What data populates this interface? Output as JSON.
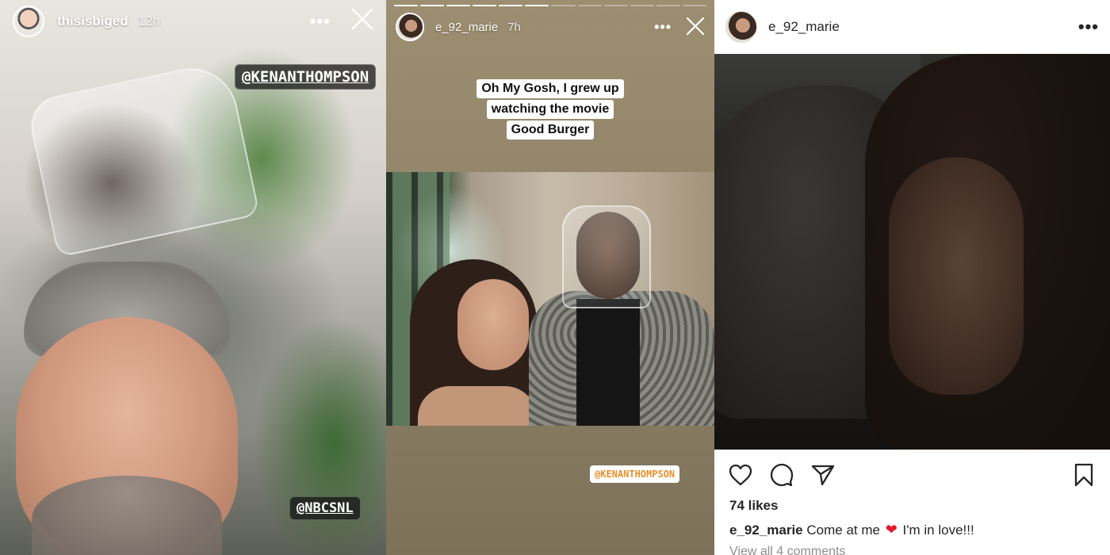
{
  "story1": {
    "username": "thisisbiged",
    "time": "12h",
    "more_icon": "more-dots-icon",
    "close_icon": "close-icon",
    "tags": {
      "kenan": "@KENANTHOMPSON",
      "nbc": "@NBCSNL"
    }
  },
  "story2": {
    "username": "e_92_marie",
    "time": "7h",
    "more_icon": "more-dots-icon",
    "close_icon": "close-icon",
    "caption_lines": [
      "Oh My Gosh, I grew up",
      "watching the movie",
      "Good Burger"
    ],
    "tag": "@KENANTHOMPSON"
  },
  "post": {
    "username": "e_92_marie",
    "more_icon": "more-dots-icon",
    "likes": "74 likes",
    "caption_user": "e_92_marie",
    "caption_text_1": "Come at me",
    "caption_heart": "❤",
    "caption_text_2": "I'm in love!!!",
    "view_comments": "View all 4 comments",
    "actions": [
      "heart-icon",
      "comment-icon",
      "share-icon",
      "bookmark-icon"
    ]
  },
  "colors": {
    "story2_background": "#9c8e70",
    "post_text": "#262626",
    "muted_text": "#8e8e8e",
    "heart": "#e0192d",
    "tag_orange": "#e8902a"
  }
}
